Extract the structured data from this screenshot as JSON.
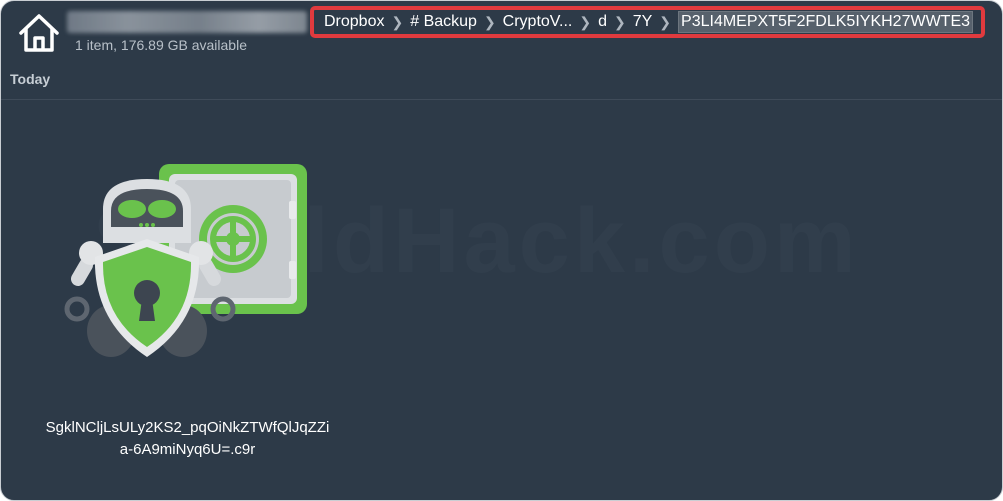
{
  "header": {
    "home_icon": "house-icon",
    "subtitle": "1 item, 176.89 GB available"
  },
  "breadcrumb": {
    "items": [
      "Dropbox",
      "# Backup",
      "CryptoV...",
      "d",
      "7Y",
      "P3LI4MEPXT5F2FDLK5IYKH27WWTE3"
    ],
    "separator_icon": "chevron-right-icon",
    "highlight_color": "#e03a3e"
  },
  "section": {
    "label": "Today"
  },
  "watermark": {
    "text": "ShieldHack.com"
  },
  "file": {
    "name_line1": "SgklNCljLsULy2KS2_pqOiNkZTWfQlJqZZi",
    "name_line2": "a-6A9miNyq6U=.c9r",
    "icon": "cryptomator-vault-icon"
  },
  "colors": {
    "background": "#2d3a48",
    "accent_green": "#6ac24c"
  }
}
